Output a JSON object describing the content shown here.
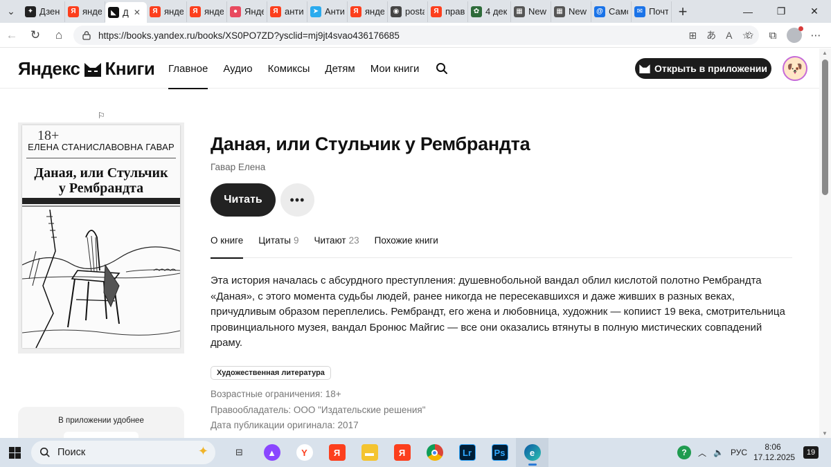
{
  "browser": {
    "tabs": [
      {
        "label": "Дзен",
        "fav_color": "#222222",
        "fav_glyph": "✦"
      },
      {
        "label": "янде",
        "fav_color": "#fc3f1d",
        "fav_glyph": "Я"
      },
      {
        "label": "Д",
        "fav_color": "#111111",
        "fav_glyph": "◣",
        "active": true
      },
      {
        "label": "янде",
        "fav_color": "#fc3f1d",
        "fav_glyph": "Я"
      },
      {
        "label": "янде",
        "fav_color": "#fc3f1d",
        "fav_glyph": "Я"
      },
      {
        "label": "Янде",
        "fav_color": "#e84a5f",
        "fav_glyph": "●"
      },
      {
        "label": "анти",
        "fav_color": "#fc3f1d",
        "fav_glyph": "Я"
      },
      {
        "label": "Анти",
        "fav_color": "#2aabee",
        "fav_glyph": "➤"
      },
      {
        "label": "янде",
        "fav_color": "#fc3f1d",
        "fav_glyph": "Я"
      },
      {
        "label": "posta",
        "fav_color": "#444444",
        "fav_glyph": "◉"
      },
      {
        "label": "прав",
        "fav_color": "#fc3f1d",
        "fav_glyph": "Я"
      },
      {
        "label": "4 дек",
        "fav_color": "#2e6b3a",
        "fav_glyph": "✿"
      },
      {
        "label": "New",
        "fav_color": "#555555",
        "fav_glyph": "▦"
      },
      {
        "label": "New",
        "fav_color": "#555555",
        "fav_glyph": "▦"
      },
      {
        "label": "Само",
        "fav_color": "#1a73e8",
        "fav_glyph": "@"
      },
      {
        "label": "Почт",
        "fav_color": "#1a73e8",
        "fav_glyph": "✉"
      }
    ],
    "url": "https://books.yandex.ru/books/XS0PO7ZD?ysclid=mj9jt4svao436176685"
  },
  "site": {
    "logo_text_left": "Яндекс",
    "logo_text_right": "Книги",
    "nav": [
      "Главное",
      "Аудио",
      "Комиксы",
      "Детям",
      "Мои книги"
    ],
    "open_app": "Открыть в приложении"
  },
  "cover": {
    "age": "18+",
    "author": "ЕЛЕНА СТАНИСЛАВОВНА ГАВАР",
    "title_line1": "Даная, или Стульчик",
    "title_line2": "у Рембрандта"
  },
  "app_promo": {
    "text": "В приложении удобнее"
  },
  "book": {
    "title": "Даная, или Стульчик у Рембрандта",
    "author": "Гавар Елена",
    "read": "Читать",
    "more": "•••",
    "tabs": [
      {
        "label": "О книге",
        "count": ""
      },
      {
        "label": "Цитаты",
        "count": "9"
      },
      {
        "label": "Читают",
        "count": "23"
      },
      {
        "label": "Похожие книги",
        "count": ""
      }
    ],
    "description": "Эта история началась с абсурдного преступления: душевнобольной вандал облил кислотой полотно Рембрандта «Даная», с этого момента судьбы людей, ранее никогда не пересекавшихся и даже живших в разных веках, причудливым образом переплелись. Рембрандт, его жена и любовница, художник — копиист 19 века, смотрительница провинциального музея, вандал Бронюс Майгис — все они оказались втянуты в полную мистических совпадений драму.",
    "genre": "Художественная литература",
    "meta": [
      "Возрастные ограничения: 18+",
      "Правообладатель: ООО \"Издательские решения\"",
      "Дата публикации оригинала: 2017"
    ]
  },
  "taskbar": {
    "search": "Поиск",
    "lang": "РУС",
    "time": "8:06",
    "date": "17.12.2025",
    "notifications": "19"
  }
}
